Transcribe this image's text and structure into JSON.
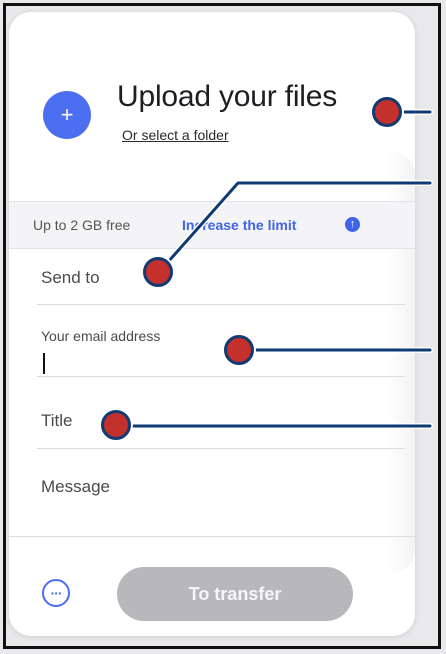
{
  "upload": {
    "icon": "plus-icon",
    "title": "Upload your files",
    "folder_link": "Or select a folder"
  },
  "limit": {
    "free_text": "Up to 2 GB free",
    "increase_link": "Increase the limit",
    "icon": "arrow-up-icon"
  },
  "fields": {
    "send_to": "Send to",
    "email_label": "Your email address",
    "email_value": "",
    "title": "Title",
    "message": "Message"
  },
  "footer": {
    "options_icon": "ellipsis-icon",
    "transfer_label": "To transfer"
  },
  "colors": {
    "accent": "#4c6ef0",
    "link": "#3f64e6",
    "disabled_button": "#b8b8bc",
    "marker": "#c4302b",
    "marker_outline": "#0f3a73"
  }
}
